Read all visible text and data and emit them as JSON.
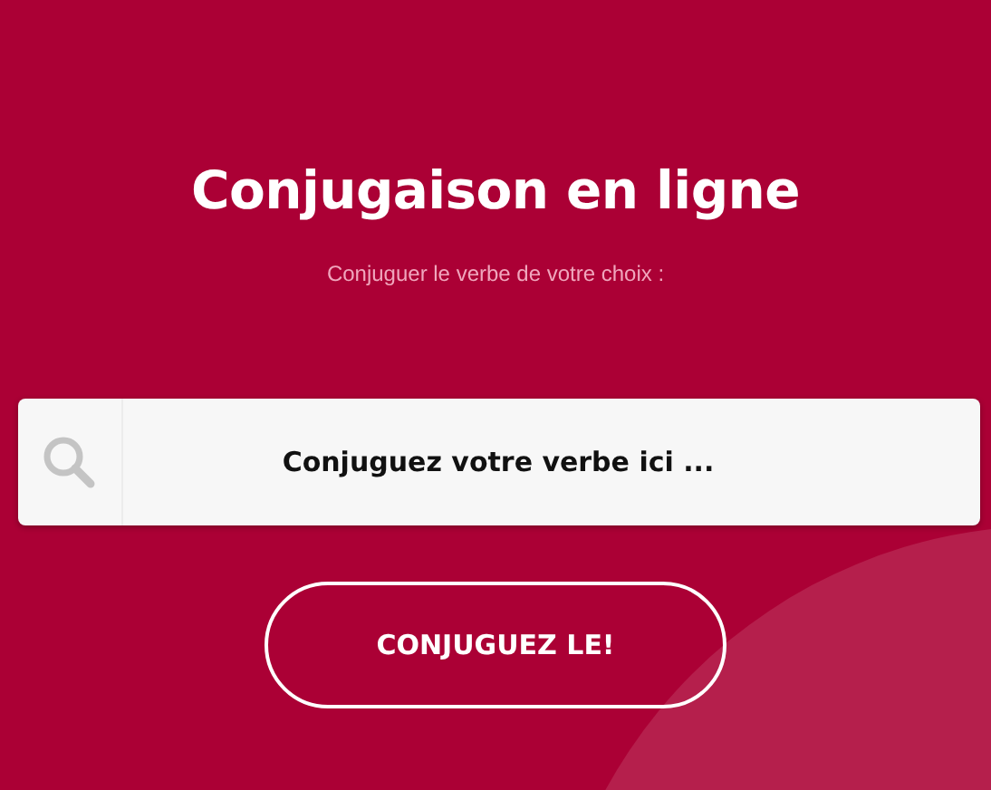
{
  "title": "Conjugaison en ligne",
  "subtitle": "Conjuguer le verbe de votre choix :",
  "search": {
    "placeholder": "Conjuguez votre verbe ici ..."
  },
  "button": "CONJUGUEZ LE!"
}
